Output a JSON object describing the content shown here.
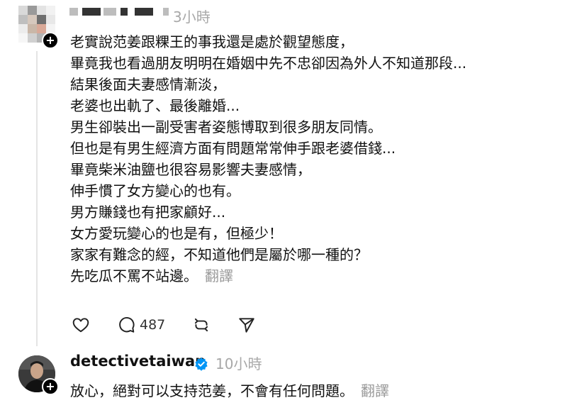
{
  "comment": {
    "time": "3小時",
    "lines": [
      "老實說范姜跟粿王的事我還是處於觀望態度，",
      "畢竟我也看過朋友明明在婚姻中先不忠卻因為外人不知道那段...",
      "結果後面夫妻感情漸淡，",
      "老婆也出軌了、最後離婚...",
      "男生卻裝出一副受害者姿態博取到很多朋友同情。",
      "但也是有男生經濟方面有問題常常伸手跟老婆借錢...",
      "畢竟柴米油鹽也很容易影響夫妻感情，",
      "伸手慣了女方變心的也有。",
      "男方賺錢也有把家顧好...",
      "女方愛玩變心的也是有，但極少！",
      "家家有難念的經，不知道他們是屬於哪一種的？",
      "先吃瓜不罵不站邊。"
    ],
    "translate_label": "翻譯",
    "reply_count": "487",
    "icons": [
      "heart-icon",
      "comment-icon",
      "repost-icon",
      "share-icon"
    ]
  },
  "reply": {
    "username": "detectivetaiwan",
    "time": "10小時",
    "text": "放心，絕對可以支持范姜，不會有任何問題。",
    "translate_label": "翻譯",
    "verified_color": "#0095f6"
  }
}
